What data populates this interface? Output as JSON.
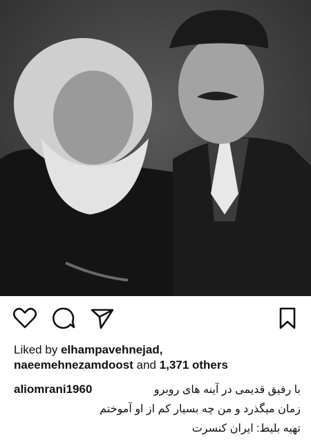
{
  "post": {
    "photo_description_icon": "photo-of-two-men",
    "actions": {
      "like_icon": "heart-icon",
      "comment_icon": "comment-bubble-icon",
      "share_icon": "paper-plane-icon",
      "save_icon": "bookmark-icon"
    },
    "likes": {
      "prefix": "Liked by",
      "user1": "elhampavehnejad,",
      "user2": "naeemehnezamdoost",
      "connector": "and",
      "count": "1,371 others"
    },
    "caption": {
      "username": "aliomrani1960",
      "line1": "با رفیق قدیمی در آینه های روبرو",
      "line2": "زمان میگذرد و من چه بسیار کم از او آموختم",
      "line3": "تهیه بلیط: ایران کنسرت"
    }
  },
  "colors": {
    "text": "#111111",
    "photo_bg": "#3a3a3a"
  }
}
